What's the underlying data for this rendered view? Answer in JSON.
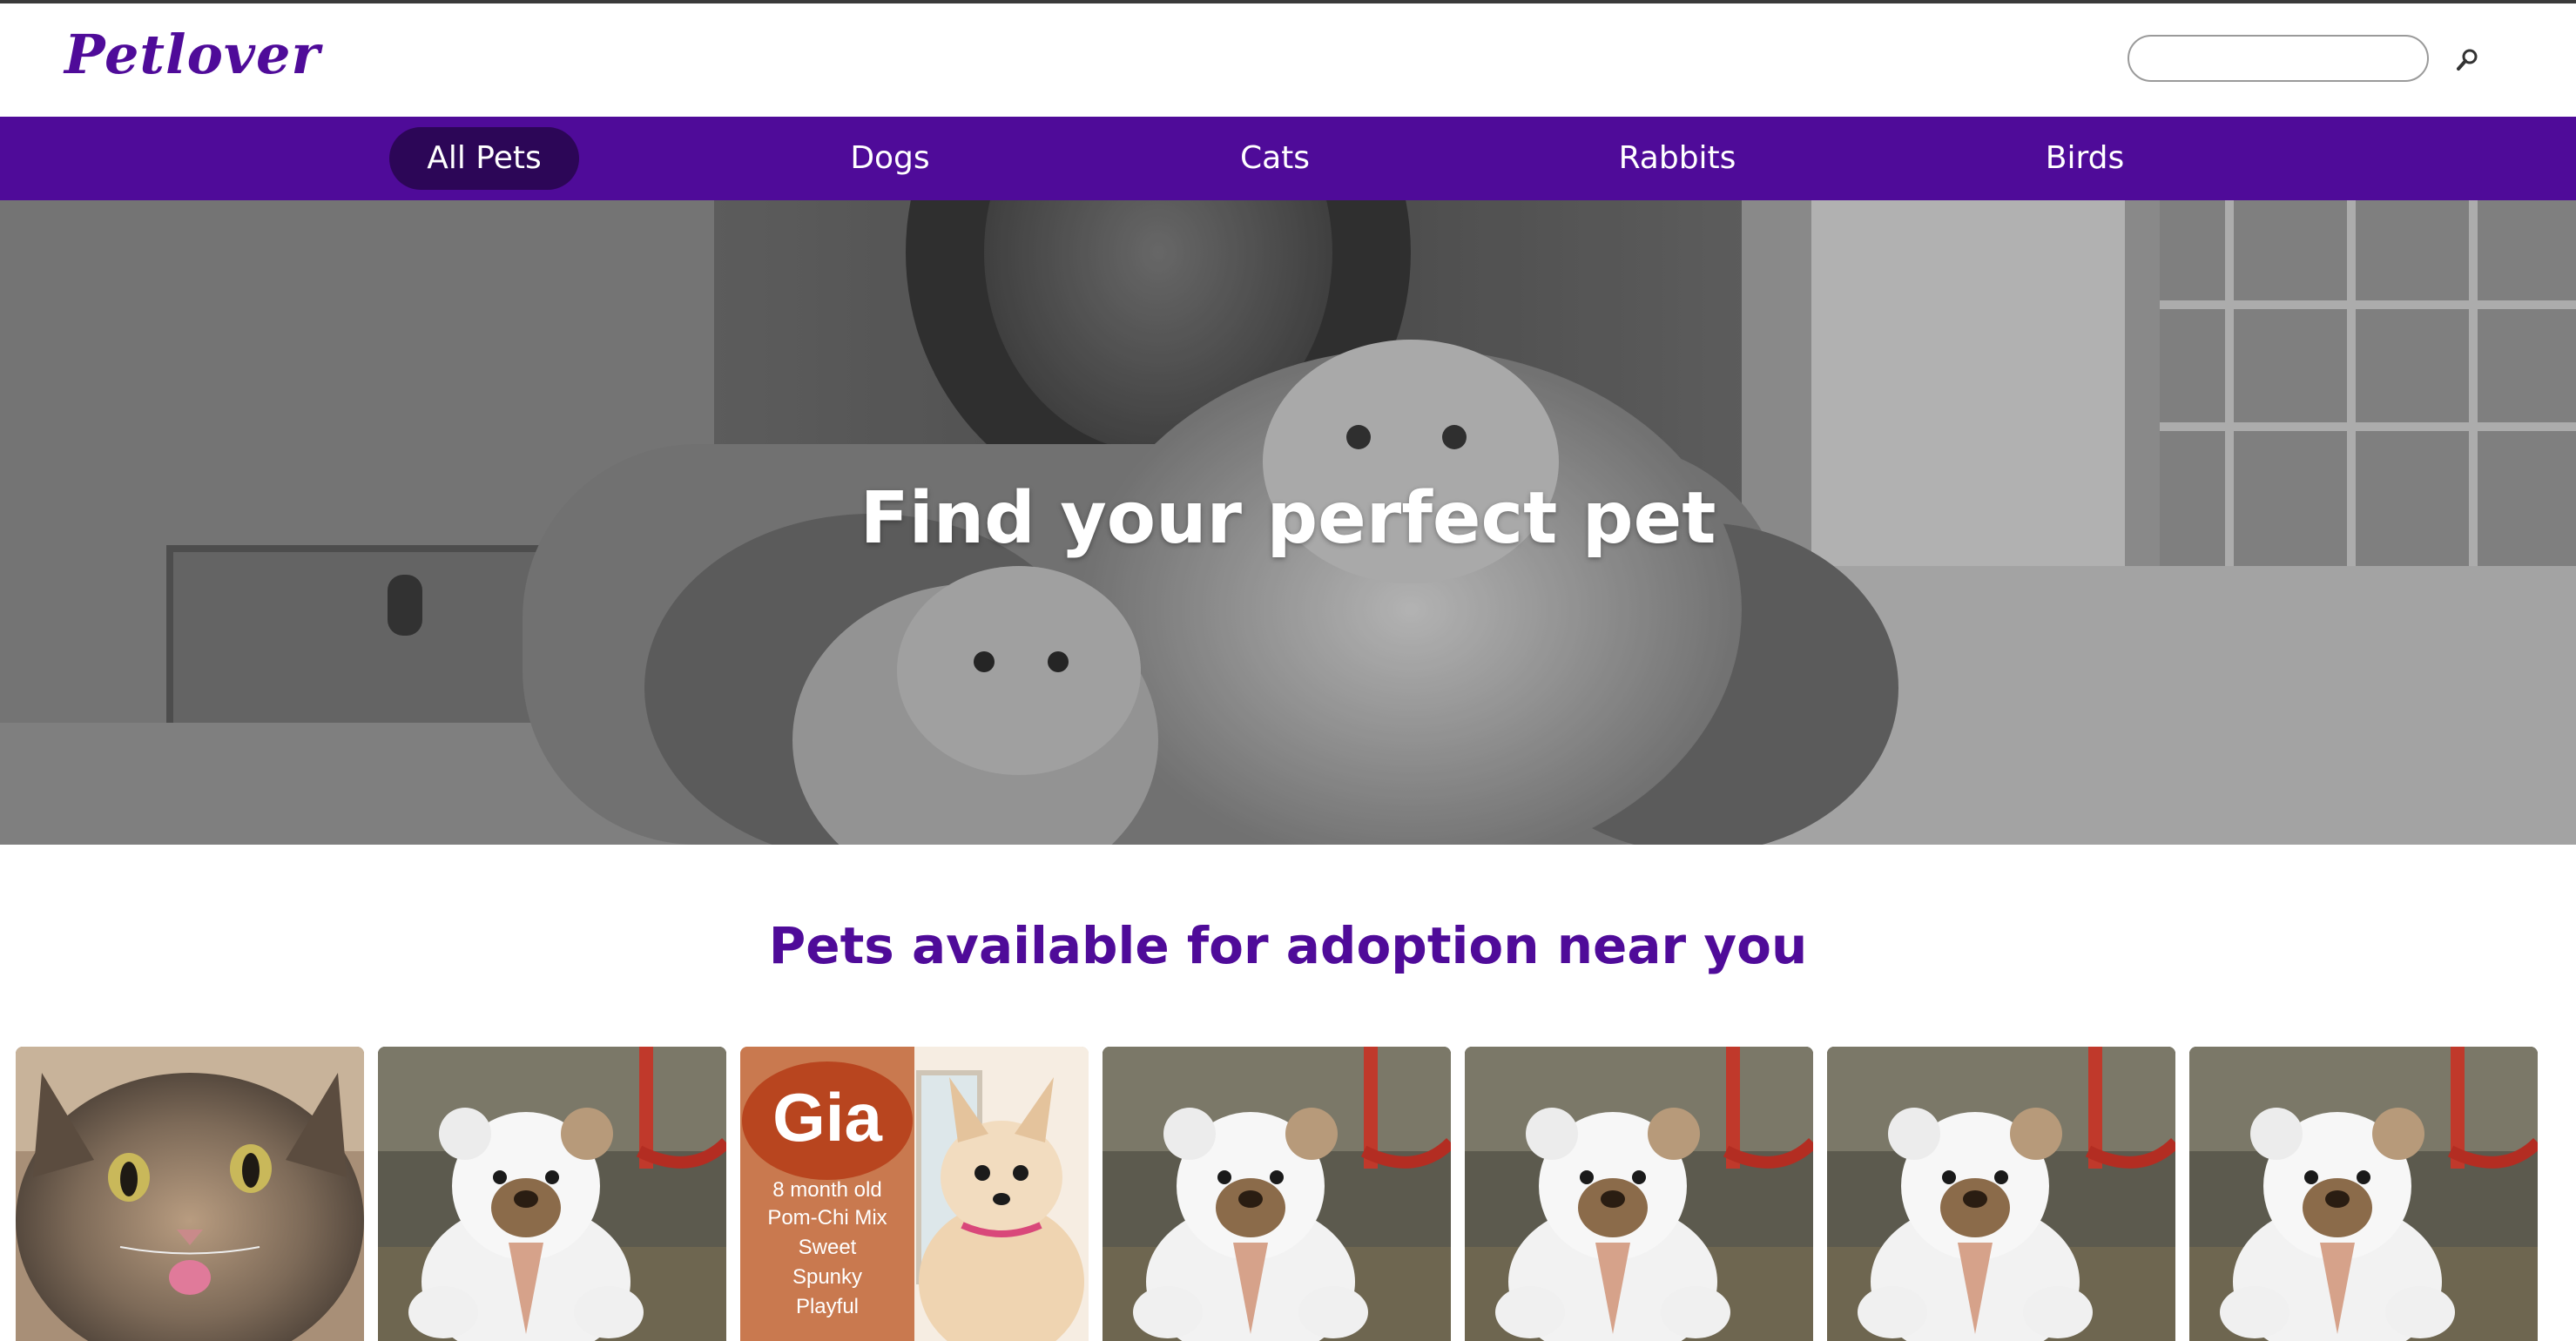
{
  "header": {
    "logo": "Petlover",
    "search": {
      "placeholder": "",
      "value": ""
    }
  },
  "nav": {
    "items": [
      {
        "label": "All Pets",
        "active": true
      },
      {
        "label": "Dogs",
        "active": false
      },
      {
        "label": "Cats",
        "active": false
      },
      {
        "label": "Rabbits",
        "active": false
      },
      {
        "label": "Birds",
        "active": false
      }
    ]
  },
  "hero": {
    "title": "Find your perfect pet"
  },
  "section": {
    "title": "Pets available for adoption near you"
  },
  "cards": [
    {
      "image": "cat-photo"
    },
    {
      "image": "teddy-bear-photo"
    },
    {
      "image": "dog-flyer-photo",
      "flyer_name": "Gia",
      "flyer_lines": [
        "8 month old",
        "Pom-Chi Mix",
        "Sweet",
        "Spunky",
        "Playful"
      ]
    },
    {
      "image": "teddy-bear-photo"
    },
    {
      "image": "teddy-bear-photo"
    },
    {
      "image": "teddy-bear-photo"
    },
    {
      "image": "teddy-bear-photo"
    }
  ],
  "colors": {
    "brand": "#4f0b99",
    "nav_active": "#2c0657",
    "white": "#ffffff"
  },
  "icons": [
    "search-icon"
  ]
}
